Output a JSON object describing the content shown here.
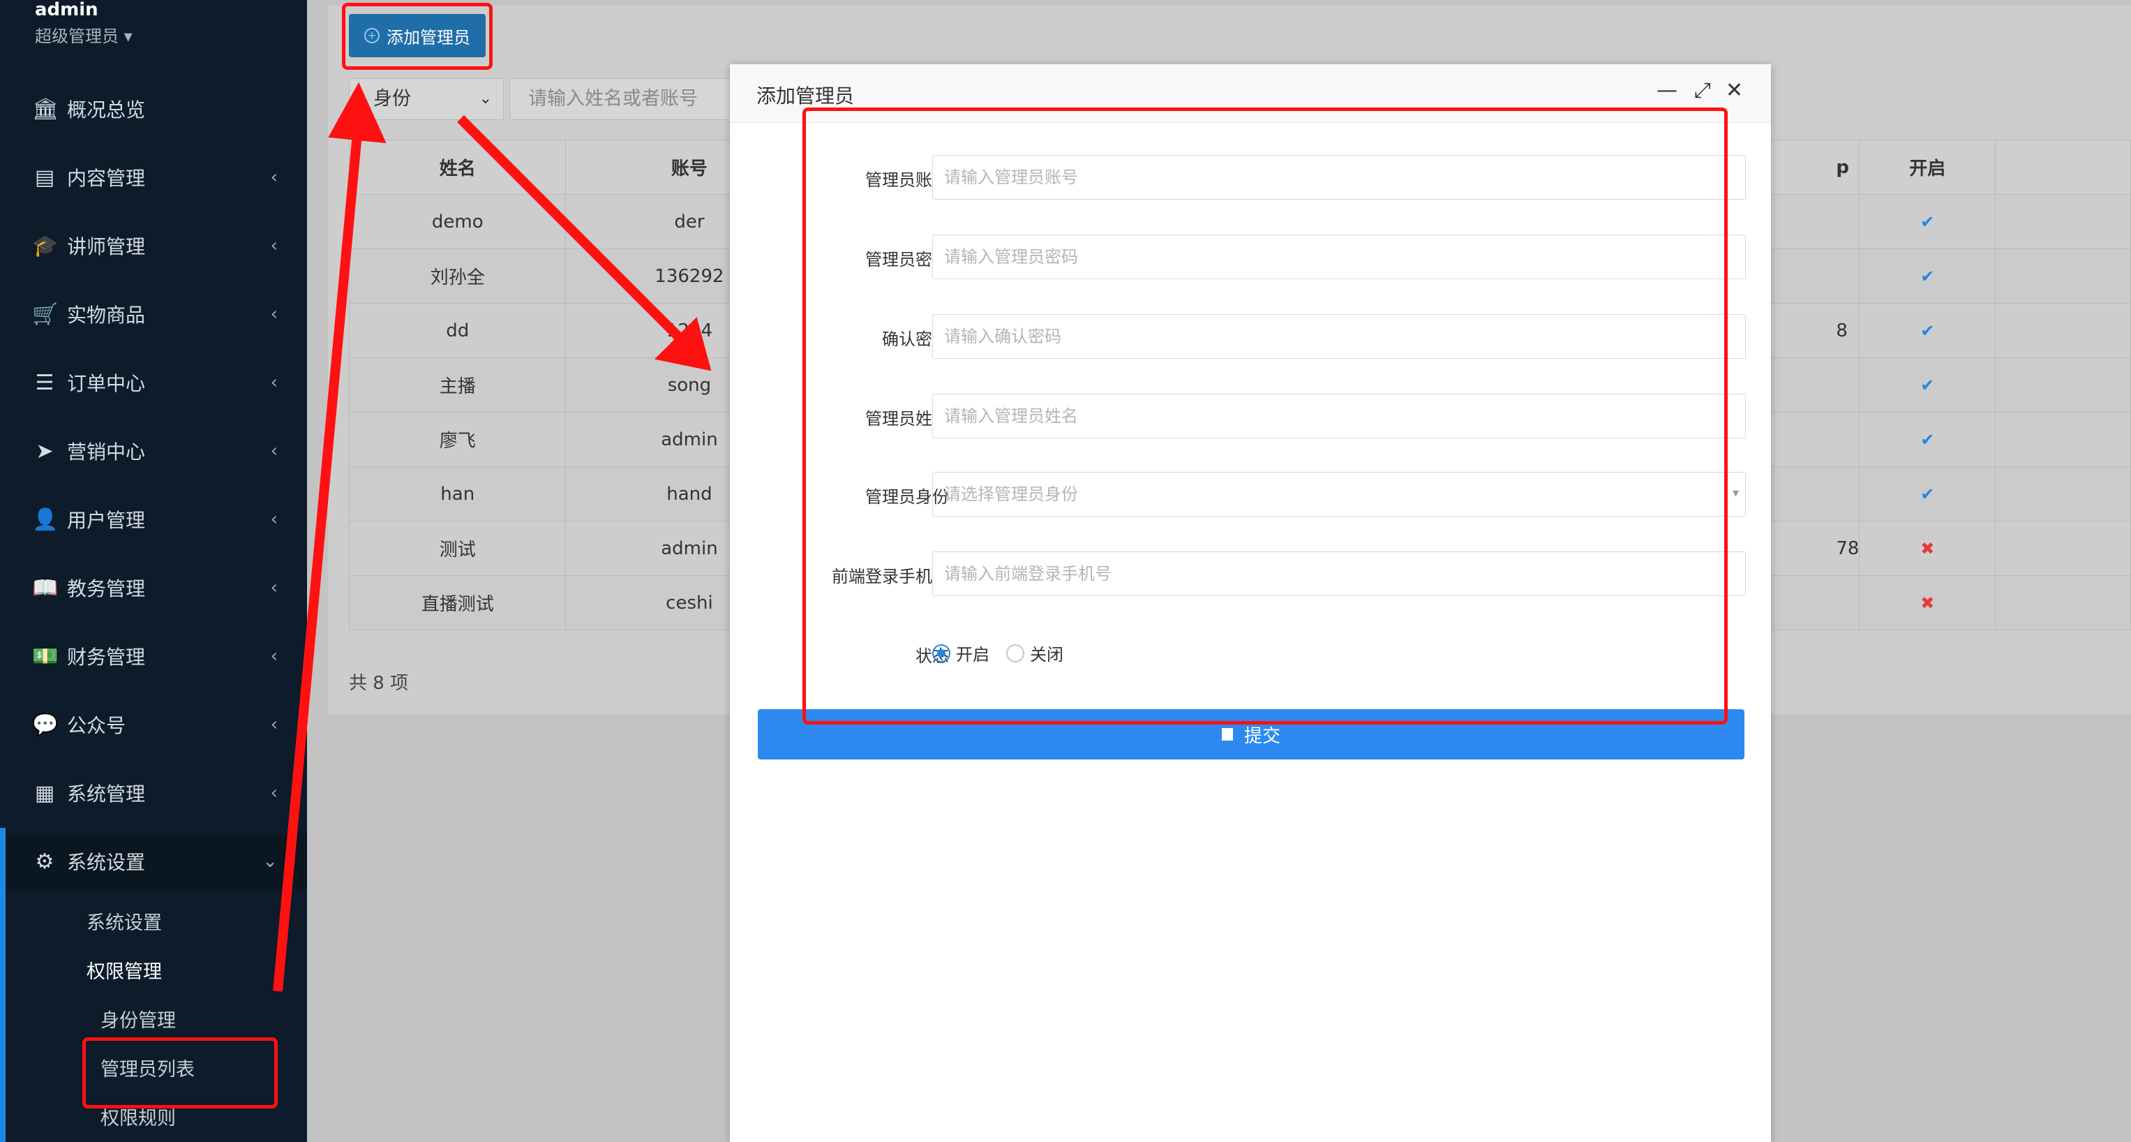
{
  "sidebar": {
    "user_name": "admin",
    "user_role": "超级管理员",
    "items": [
      {
        "label": "概况总览",
        "icon": "bank-icon",
        "glyph": "🏛"
      },
      {
        "label": "内容管理",
        "icon": "newspaper-icon",
        "glyph": "▤"
      },
      {
        "label": "讲师管理",
        "icon": "graduation-cap-icon",
        "glyph": "🎓"
      },
      {
        "label": "实物商品",
        "icon": "cart-icon",
        "glyph": "🛒"
      },
      {
        "label": "订单中心",
        "icon": "list-icon",
        "glyph": "☰"
      },
      {
        "label": "营销中心",
        "icon": "paper-plane-icon",
        "glyph": "➤"
      },
      {
        "label": "用户管理",
        "icon": "user-icon",
        "glyph": "👤"
      },
      {
        "label": "教务管理",
        "icon": "book-icon",
        "glyph": "📖"
      },
      {
        "label": "财务管理",
        "icon": "money-icon",
        "glyph": "💵"
      },
      {
        "label": "公众号",
        "icon": "wechat-icon",
        "glyph": "💬"
      },
      {
        "label": "系统管理",
        "icon": "grid-icon",
        "glyph": "▦"
      },
      {
        "label": "系统设置",
        "icon": "gear-icon",
        "glyph": "⚙"
      }
    ],
    "sub_items": {
      "system_settings": "系统设置",
      "permission": "权限管理",
      "role": "身份管理",
      "admin_list": "管理员列表",
      "rules": "权限规则"
    }
  },
  "toolbar": {
    "add_label": "添加管理员",
    "role_select": "身份",
    "search_placeholder": "请输入姓名或者账号"
  },
  "table": {
    "headers": [
      "姓名",
      "账号",
      "p",
      "开启"
    ],
    "rows": [
      {
        "name": "demo",
        "account": "der",
        "phone": "",
        "enabled": true
      },
      {
        "name": "刘孙全",
        "account": "136292",
        "phone": "",
        "enabled": true
      },
      {
        "name": "dd",
        "account": "1234",
        "phone": "8",
        "enabled": true
      },
      {
        "name": "主播",
        "account": "song",
        "phone": "",
        "enabled": true
      },
      {
        "name": "廖飞",
        "account": "admin",
        "phone": "",
        "enabled": true
      },
      {
        "name": "han",
        "account": "hand",
        "phone": "",
        "enabled": true
      },
      {
        "name": "测试",
        "account": "admin",
        "phone": "78",
        "enabled": false
      },
      {
        "name": "直播测试",
        "account": "ceshi",
        "phone": "",
        "enabled": false
      }
    ],
    "total": "共 8 项",
    "check_glyph": "✔",
    "cross_glyph": "✖"
  },
  "modal": {
    "title": "添加管理员",
    "fields": {
      "account_label": "管理员账号",
      "account_placeholder": "请输入管理员账号",
      "password_label": "管理员密码",
      "password_placeholder": "请输入管理员密码",
      "confirm_label": "确认密码",
      "confirm_placeholder": "请输入确认密码",
      "name_label": "管理员姓名",
      "name_placeholder": "请输入管理员姓名",
      "role_label": "管理员身份",
      "role_placeholder": "请选择管理员身份",
      "phone_label": "前端登录手机号",
      "phone_placeholder": "请输入前端登录手机号",
      "status_label": "状态",
      "status_on": "开启",
      "status_off": "关闭"
    },
    "submit_label": "提交"
  },
  "colors": {
    "sidebar_bg": "#0d1b2a",
    "primary": "#2d89ef",
    "annotation": "#ff1111",
    "check": "#1e88e5",
    "cross": "#e53935"
  }
}
